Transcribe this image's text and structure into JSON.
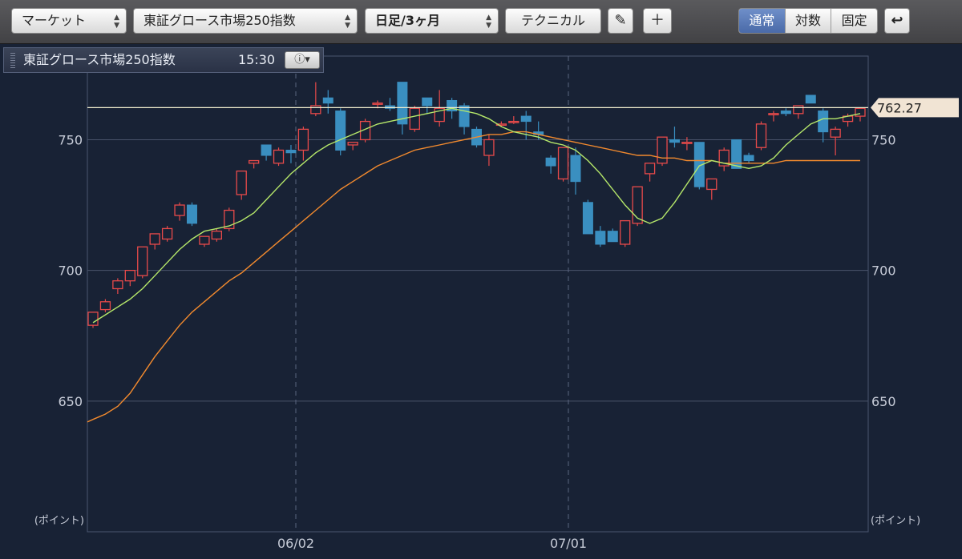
{
  "toolbar": {
    "market_label": "マーケット",
    "index_label": "東証グロース市場250指数",
    "period_label": "日足/3ヶ月",
    "technical_label": "テクニカル",
    "scale_modes": [
      "通常",
      "対数",
      "固定"
    ],
    "active_scale": "通常"
  },
  "infobar": {
    "name": "東証グロース市場250指数",
    "time": "15:30"
  },
  "colors": {
    "up": "#e84a4a",
    "down": "#3a8fc0",
    "ma_short": "#b6e86a",
    "ma_long": "#f28a2e",
    "price_line": "#f3f0d0"
  },
  "chart_data": {
    "type": "candlestick",
    "y_axis_unit": "(ポイント)",
    "ylim": [
      600,
      782
    ],
    "yticks": [
      650,
      700,
      750
    ],
    "x_ticks": [
      "06/02",
      "07/01"
    ],
    "last_price": "762.27",
    "candles": [
      [
        679,
        684,
        678,
        684
      ],
      [
        685,
        689,
        684,
        688
      ],
      [
        693,
        697,
        691,
        696
      ],
      [
        696,
        700,
        694,
        700
      ],
      [
        698,
        709,
        697,
        709
      ],
      [
        710,
        714,
        708,
        714
      ],
      [
        712,
        717,
        711,
        716
      ],
      [
        721,
        726,
        719,
        725
      ],
      [
        725,
        726,
        717,
        718
      ],
      [
        710,
        713,
        709,
        713
      ],
      [
        712,
        716,
        711,
        715
      ],
      [
        716,
        724,
        715,
        723
      ],
      [
        729,
        738,
        727,
        738
      ],
      [
        741,
        742,
        739,
        742
      ],
      [
        748,
        747,
        742,
        744
      ],
      [
        741,
        747,
        740,
        746
      ],
      [
        746,
        748,
        741,
        745
      ],
      [
        746,
        755,
        742,
        754
      ],
      [
        760,
        772,
        759,
        763
      ],
      [
        766,
        769,
        760,
        764
      ],
      [
        761,
        762,
        744,
        746
      ],
      [
        748,
        749,
        746,
        749
      ],
      [
        750,
        758,
        749,
        757
      ],
      [
        764,
        765,
        762,
        764
      ],
      [
        763,
        766,
        761,
        762
      ],
      [
        772,
        772,
        752,
        756
      ],
      [
        754,
        763,
        753,
        762
      ],
      [
        766,
        766,
        760,
        763
      ],
      [
        757,
        769,
        755,
        762
      ],
      [
        765,
        766,
        758,
        761
      ],
      [
        763,
        764,
        752,
        755
      ],
      [
        754,
        755,
        747,
        748
      ],
      [
        744,
        752,
        740,
        750
      ],
      [
        756,
        757,
        755,
        756
      ],
      [
        757,
        759,
        756,
        757
      ],
      [
        759,
        761,
        750,
        757
      ],
      [
        753,
        757,
        750,
        752
      ],
      [
        743,
        744,
        737,
        740
      ],
      [
        735,
        747,
        734,
        747
      ],
      [
        744,
        747,
        729,
        734
      ],
      [
        726,
        727,
        714,
        714
      ],
      [
        715,
        717,
        709,
        710
      ],
      [
        715,
        716,
        711,
        711
      ],
      [
        710,
        719,
        709,
        719
      ],
      [
        718,
        732,
        717,
        732
      ],
      [
        737,
        741,
        734,
        741
      ],
      [
        741,
        751,
        740,
        751
      ],
      [
        750,
        755,
        747,
        749
      ],
      [
        749,
        751,
        746,
        749
      ],
      [
        749,
        749,
        731,
        732
      ],
      [
        731,
        735,
        727,
        735
      ],
      [
        740,
        747,
        738,
        746
      ],
      [
        750,
        750,
        740,
        739
      ],
      [
        744,
        745,
        741,
        742
      ],
      [
        747,
        757,
        746,
        756
      ],
      [
        760,
        761,
        757,
        760
      ],
      [
        761,
        762,
        759,
        760
      ],
      [
        760,
        763,
        758,
        763
      ],
      [
        767,
        767,
        764,
        764
      ],
      [
        761,
        762,
        749,
        753
      ],
      [
        751,
        755,
        744,
        754
      ],
      [
        757,
        760,
        755,
        759
      ],
      [
        759,
        762,
        757,
        762
      ]
    ],
    "ma_short": [
      680,
      683,
      686,
      689,
      693,
      698,
      703,
      708,
      712,
      715,
      716,
      717,
      719,
      722,
      727,
      732,
      737,
      741,
      745,
      748,
      750,
      752,
      754,
      756,
      757,
      758,
      759,
      760,
      761,
      762,
      761,
      760,
      758,
      755,
      753,
      752,
      751,
      749,
      748,
      746,
      742,
      737,
      731,
      725,
      720,
      718,
      720,
      726,
      733,
      740,
      742,
      741,
      740,
      739,
      740,
      743,
      748,
      752,
      756,
      758,
      758,
      759,
      760
    ],
    "ma_long": [
      643,
      645,
      648,
      653,
      660,
      667,
      673,
      679,
      684,
      688,
      692,
      696,
      699,
      703,
      707,
      711,
      715,
      719,
      723,
      727,
      731,
      734,
      737,
      740,
      742,
      744,
      746,
      747,
      748,
      749,
      750,
      751,
      752,
      752,
      753,
      753,
      752,
      751,
      750,
      749,
      748,
      747,
      746,
      745,
      744,
      744,
      743,
      743,
      742,
      742,
      742,
      741,
      741,
      741,
      741,
      741,
      742,
      742,
      742,
      742,
      742,
      742,
      742
    ]
  }
}
